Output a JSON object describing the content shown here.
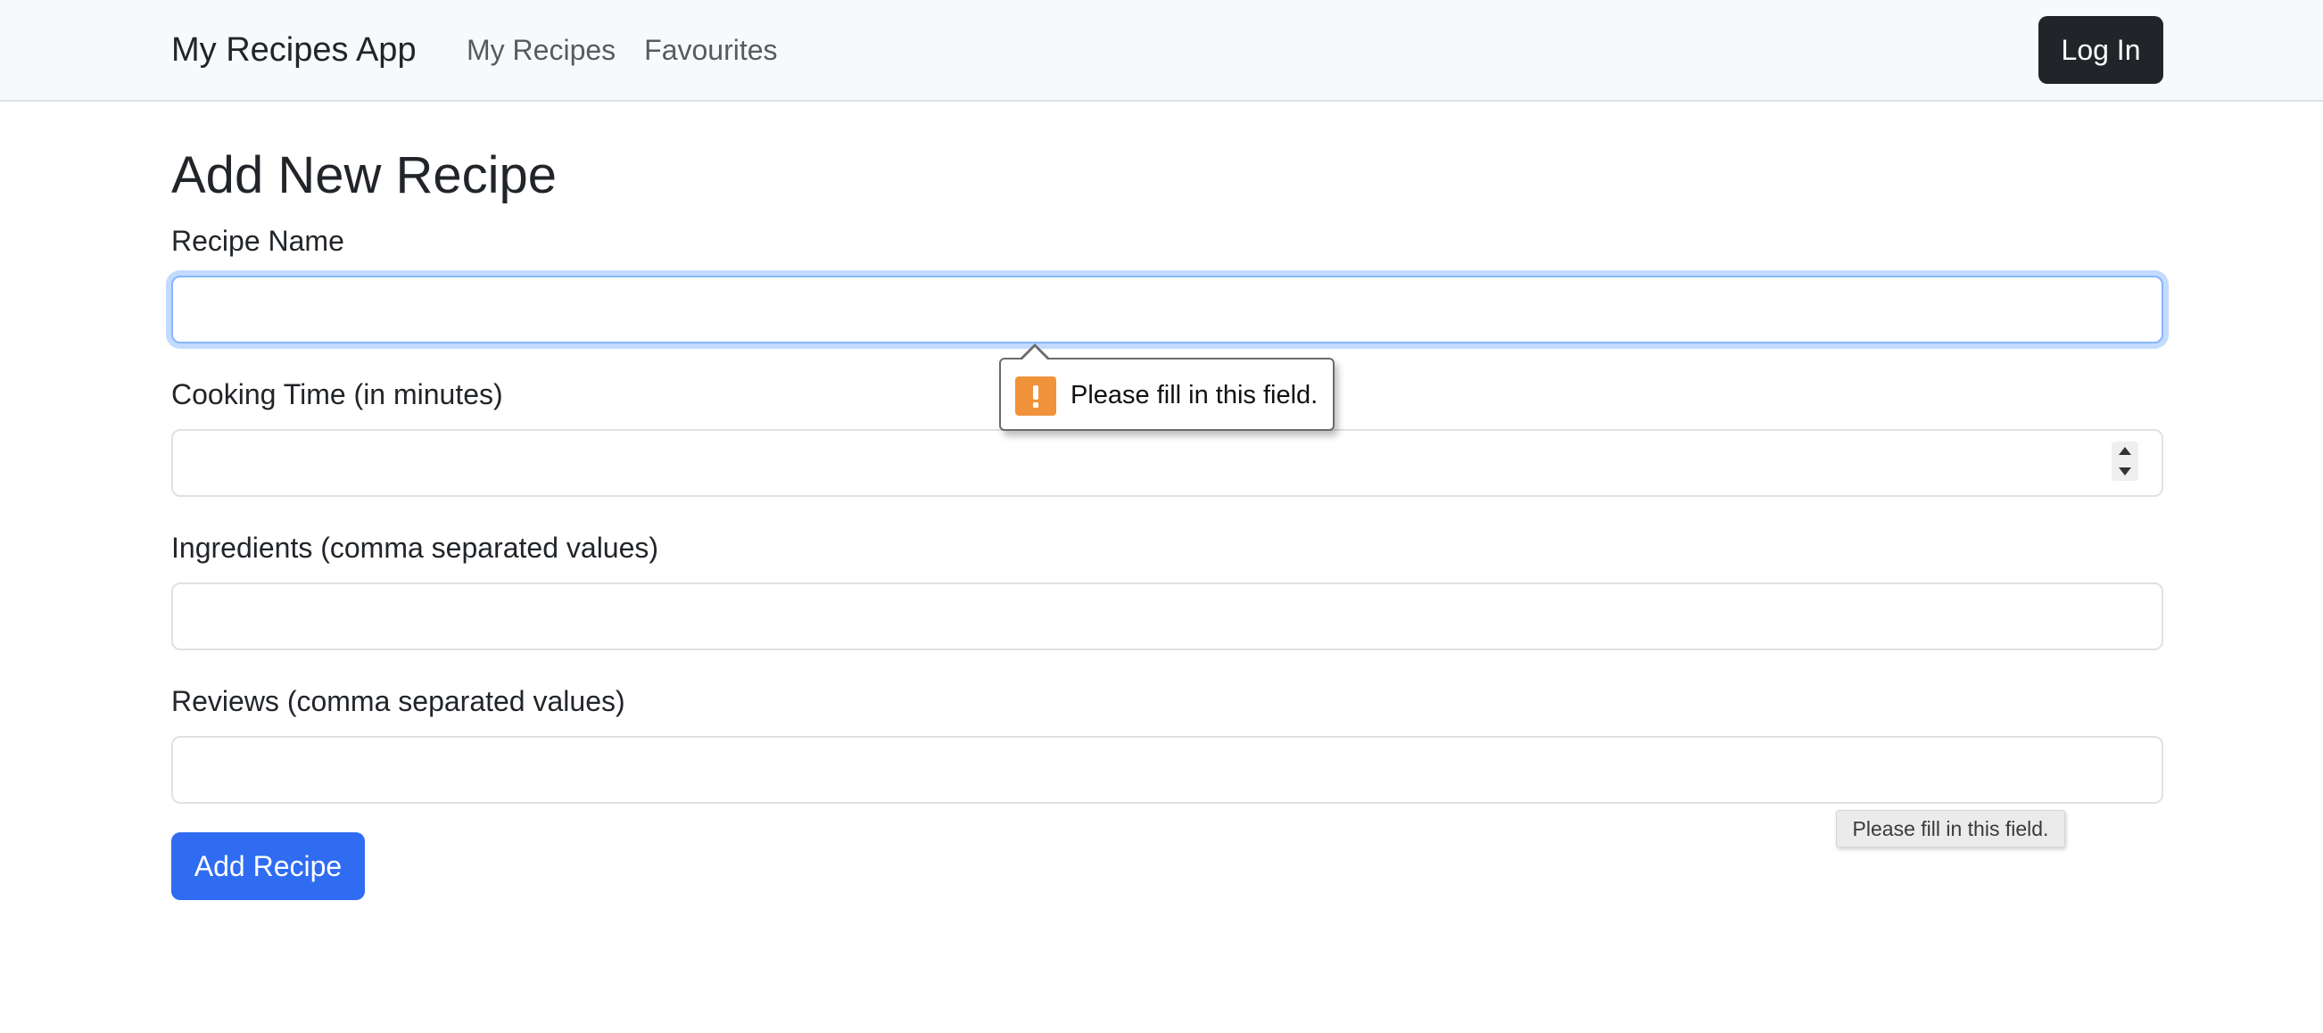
{
  "navbar": {
    "brand": "My Recipes App",
    "links": [
      "My Recipes",
      "Favourites"
    ],
    "login_label": "Log In"
  },
  "form": {
    "title": "Add New Recipe",
    "fields": [
      {
        "label": "Recipe Name",
        "value": ""
      },
      {
        "label": "Cooking Time (in minutes)",
        "value": ""
      },
      {
        "label": "Ingredients (comma separated values)",
        "value": ""
      },
      {
        "label": "Reviews (comma separated values)",
        "value": ""
      }
    ],
    "submit_label": "Add Recipe"
  },
  "validation": {
    "message": "Please fill in this field.",
    "icon": "warning-icon",
    "icon_color": "#f0923a"
  },
  "tooltip": {
    "text": "Please fill in this field."
  },
  "colors": {
    "navbar_bg": "#f8f9fa",
    "primary": "#0d6efd",
    "dark": "#212529",
    "focus_ring": "#86b7fe"
  }
}
